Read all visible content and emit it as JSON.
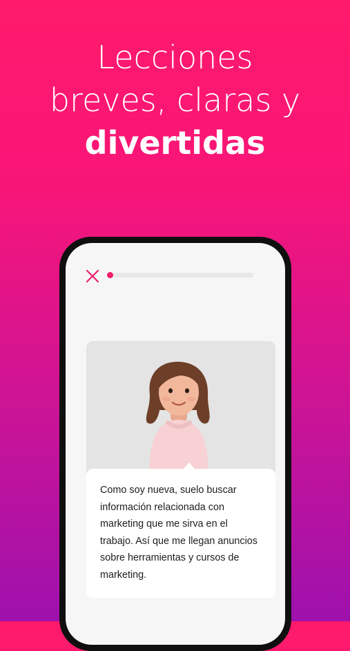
{
  "headline": {
    "line1": "Lecciones",
    "line2": "breves, claras y",
    "line3": "divertidas"
  },
  "lesson": {
    "close_icon": "close-icon",
    "progress": 0.03,
    "avatar_description_icon": "avatar-illustration",
    "speech": "Como soy nueva, suelo buscar información relacionada con marketing que me sirva en el trabajo. Así que me llegan anuncios sobre herramientas y cursos de marketing."
  },
  "colors": {
    "accent": "#ef1f6a",
    "gradient_top": "#ff1a6b",
    "gradient_bottom": "#9e11ad"
  }
}
